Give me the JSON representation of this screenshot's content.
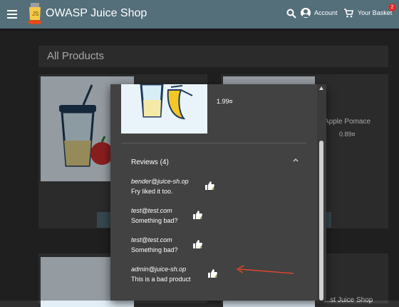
{
  "header": {
    "title": "OWASP Juice Shop",
    "account_label": "Account",
    "basket_label": "Your Basket",
    "basket_count": "2",
    "bar_color": "#546e7a"
  },
  "main": {
    "section_title": "All Products",
    "cards": [
      {
        "name": "Apple Pomace",
        "price": "0.89¤"
      },
      {
        "name": "...st Juice Shop"
      }
    ]
  },
  "dialog": {
    "price": "1.99¤",
    "reviews_title": "Reviews (4)",
    "reviews": [
      {
        "author": "bender@juice-sh.op",
        "message": "Fry liked it too."
      },
      {
        "author": "test@test.com",
        "message": "Something bad?"
      },
      {
        "author": "test@test.com",
        "message": "Something bad?"
      },
      {
        "author": "admin@juice-sh.op",
        "message": "This is a bad product"
      }
    ]
  },
  "icons": {
    "menu": "menu-icon",
    "search": "search-icon",
    "account": "account-icon",
    "cart": "cart-icon",
    "like": "thumb-up-icon",
    "collapse": "chevron-up-icon"
  },
  "colors": {
    "arrow": "#e0452b",
    "like_accent": "#8bc34a"
  }
}
